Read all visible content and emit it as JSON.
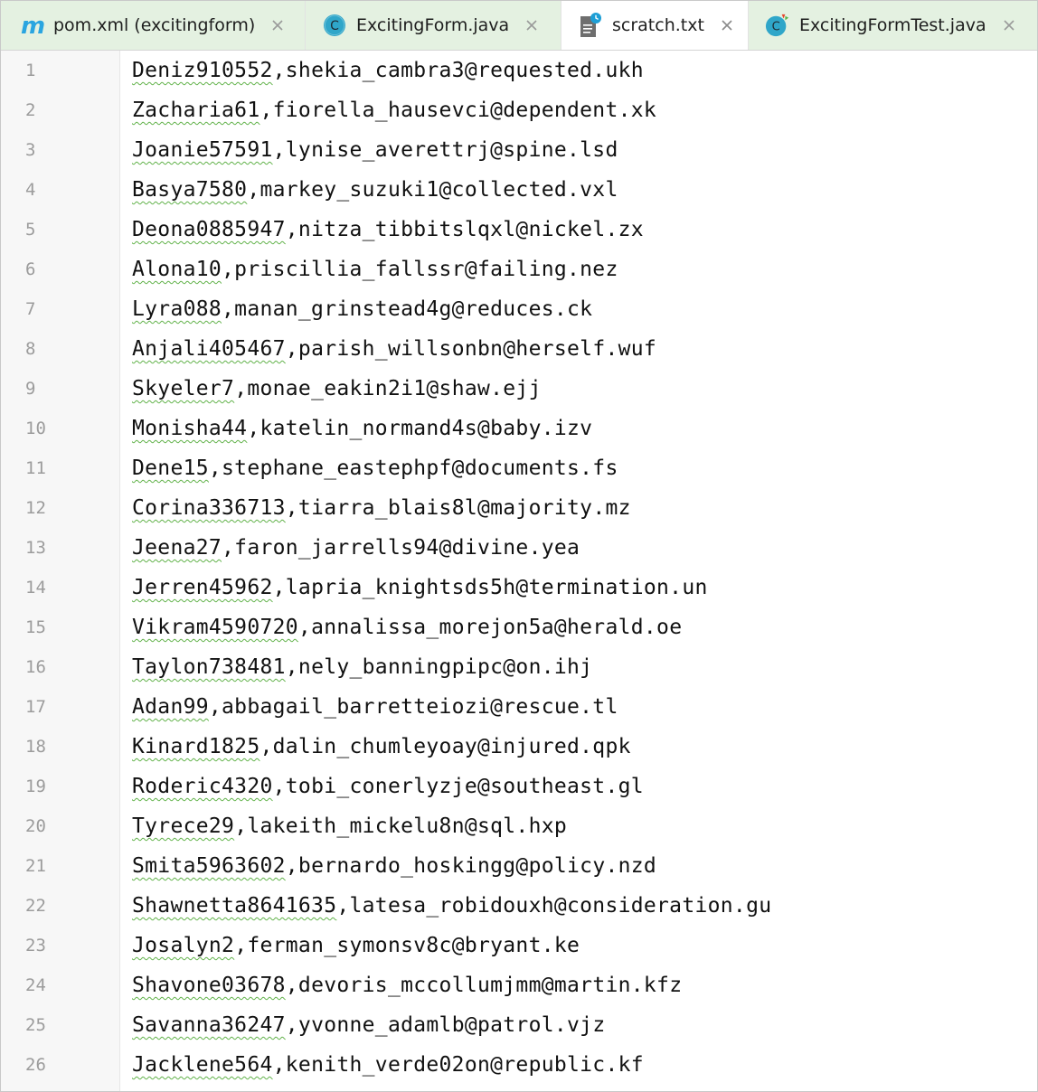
{
  "tabs": [
    {
      "label": "pom.xml (excitingform)",
      "icon": "maven-icon",
      "state": "tinted"
    },
    {
      "label": "ExcitingForm.java",
      "icon": "java-class-icon",
      "state": "tinted"
    },
    {
      "label": "scratch.txt",
      "icon": "scratch-file-icon",
      "state": "active"
    },
    {
      "label": "ExcitingFormTest.java",
      "icon": "java-test-class-icon",
      "state": "tinted"
    }
  ],
  "colors": {
    "tab_tint": "#e4f1e1",
    "maven_icon": "#2aa5e0",
    "class_icon": "#2fa6c9",
    "squiggle": "#61b24a",
    "line_number": "#9c9c9c"
  },
  "editor": {
    "lines": [
      {
        "number": "1",
        "name": "Deniz910552",
        "rest": ",shekia_cambra3@requested.ukh"
      },
      {
        "number": "2",
        "name": "Zacharia61",
        "rest": ",fiorella_hausevci@dependent.xk"
      },
      {
        "number": "3",
        "name": "Joanie57591",
        "rest": ",lynise_averettrj@spine.lsd"
      },
      {
        "number": "4",
        "name": "Basya7580",
        "rest": ",markey_suzuki1@collected.vxl"
      },
      {
        "number": "5",
        "name": "Deona0885947",
        "rest": ",nitza_tibbitslqxl@nickel.zx"
      },
      {
        "number": "6",
        "name": "Alona10",
        "rest": ",priscillia_fallssr@failing.nez"
      },
      {
        "number": "7",
        "name": "Lyra088",
        "rest": ",manan_grinstead4g@reduces.ck"
      },
      {
        "number": "8",
        "name": "Anjali405467",
        "rest": ",parish_willsonbn@herself.wuf"
      },
      {
        "number": "9",
        "name": "Skyeler7",
        "rest": ",monae_eakin2i1@shaw.ejj"
      },
      {
        "number": "10",
        "name": "Monisha44",
        "rest": ",katelin_normand4s@baby.izv"
      },
      {
        "number": "11",
        "name": "Dene15",
        "rest": ",stephane_eastephpf@documents.fs"
      },
      {
        "number": "12",
        "name": "Corina336713",
        "rest": ",tiarra_blais8l@majority.mz"
      },
      {
        "number": "13",
        "name": "Jeena27",
        "rest": ",faron_jarrells94@divine.yea"
      },
      {
        "number": "14",
        "name": "Jerren45962",
        "rest": ",lapria_knightsds5h@termination.un"
      },
      {
        "number": "15",
        "name": "Vikram4590720",
        "rest": ",annalissa_morejon5a@herald.oe"
      },
      {
        "number": "16",
        "name": "Taylon738481",
        "rest": ",nely_banningpipc@on.ihj"
      },
      {
        "number": "17",
        "name": "Adan99",
        "rest": ",abbagail_barretteiozi@rescue.tl"
      },
      {
        "number": "18",
        "name": "Kinard1825",
        "rest": ",dalin_chumleyoay@injured.qpk"
      },
      {
        "number": "19",
        "name": "Roderic4320",
        "rest": ",tobi_conerlyzje@southeast.gl"
      },
      {
        "number": "20",
        "name": "Tyrece29",
        "rest": ",lakeith_mickelu8n@sql.hxp"
      },
      {
        "number": "21",
        "name": "Smita5963602",
        "rest": ",bernardo_hoskingg@policy.nzd"
      },
      {
        "number": "22",
        "name": "Shawnetta8641635",
        "rest": ",latesa_robidouxh@consideration.gu"
      },
      {
        "number": "23",
        "name": "Josalyn2",
        "rest": ",ferman_symonsv8c@bryant.ke"
      },
      {
        "number": "24",
        "name": "Shavone03678",
        "rest": ",devoris_mccollumjmm@martin.kfz"
      },
      {
        "number": "25",
        "name": "Savanna36247",
        "rest": ",yvonne_adamlb@patrol.vjz"
      },
      {
        "number": "26",
        "name": "Jacklene564",
        "rest": ",kenith_verde02on@republic.kf"
      }
    ]
  }
}
